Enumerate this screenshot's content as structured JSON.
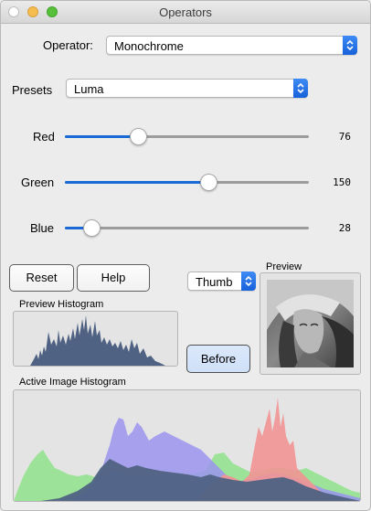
{
  "window": {
    "title": "Operators"
  },
  "operator": {
    "label": "Operator:",
    "value": "Monochrome"
  },
  "presets": {
    "label": "Presets",
    "value": "Luma"
  },
  "sliders": [
    {
      "label": "Red",
      "value": "76",
      "level": 76,
      "max": 255
    },
    {
      "label": "Green",
      "value": "150",
      "level": 150,
      "max": 255
    },
    {
      "label": "Blue",
      "value": "28",
      "level": 28,
      "max": 255
    }
  ],
  "buttons": {
    "reset": "Reset",
    "help": "Help",
    "before": "Before"
  },
  "thumb_select": {
    "value": "Thumb"
  },
  "preview": {
    "label": "Preview"
  },
  "preview_histogram": {
    "label": "Preview Histogram"
  },
  "active_histogram": {
    "label": "Active Image Histogram"
  },
  "colors": {
    "accent": "#1a6ad6",
    "red": "#f19494",
    "green": "#8fe38c",
    "blue": "#9b94ee",
    "gray": "#4f6283"
  }
}
